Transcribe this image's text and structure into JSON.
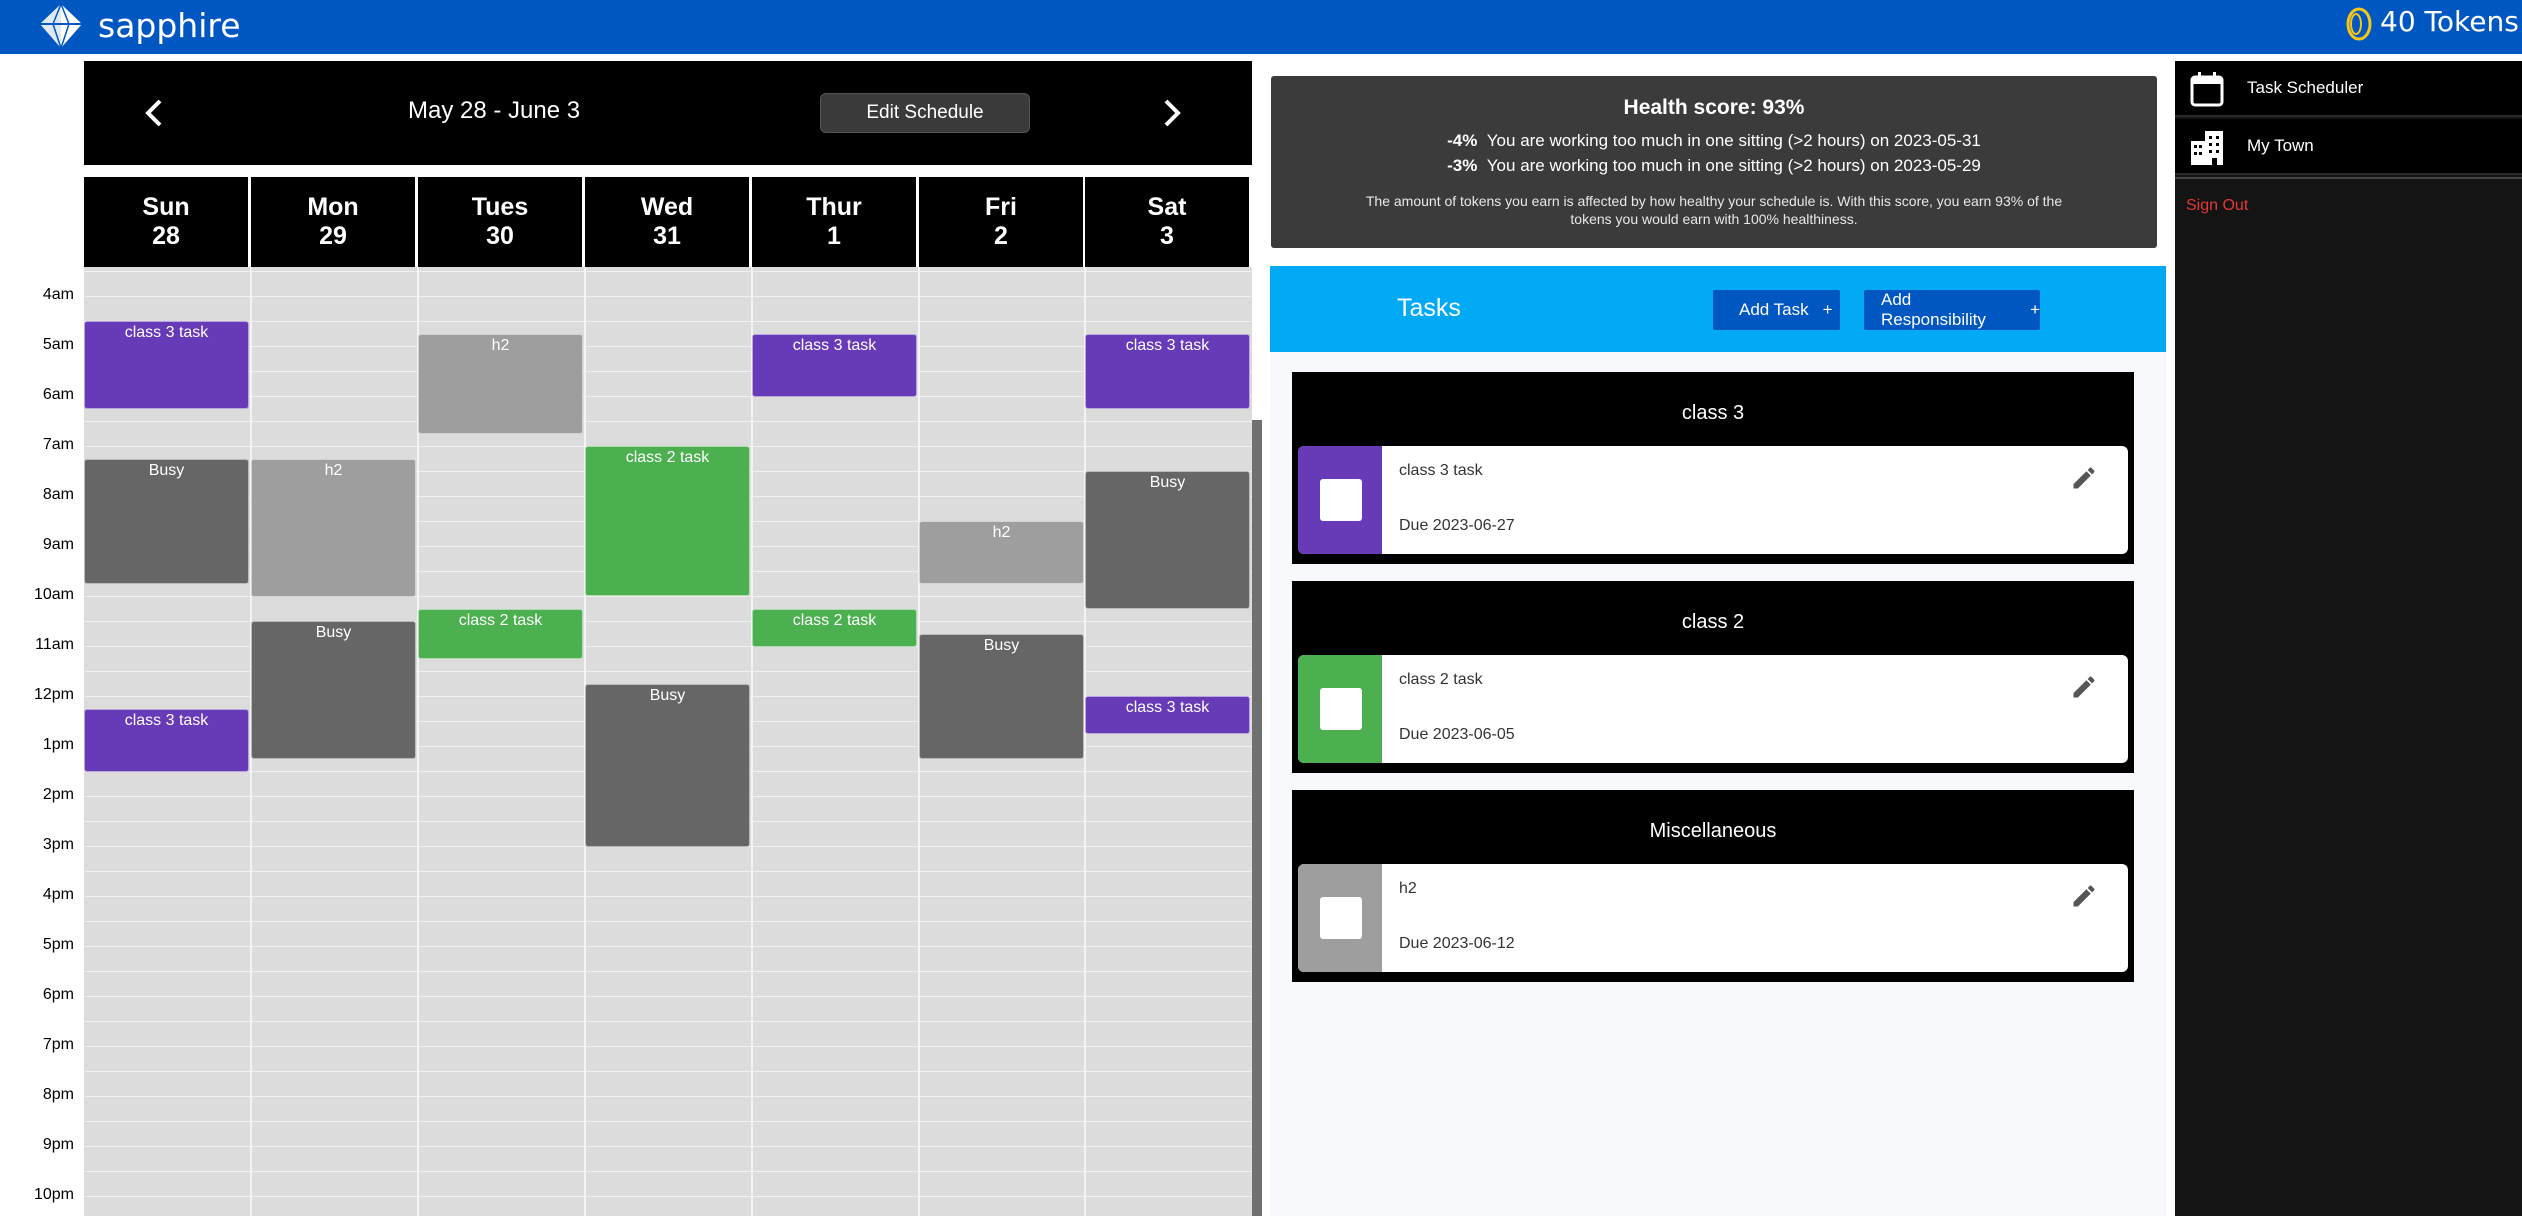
{
  "app": {
    "brand": "sapphire",
    "tokens": "40 Tokens"
  },
  "calendar": {
    "date_range": "May 28 - June 3",
    "edit_label": "Edit Schedule",
    "days": [
      {
        "name": "Sun",
        "num": "28"
      },
      {
        "name": "Mon",
        "num": "29"
      },
      {
        "name": "Tues",
        "num": "30"
      },
      {
        "name": "Wed",
        "num": "31"
      },
      {
        "name": "Thur",
        "num": "1"
      },
      {
        "name": "Fri",
        "num": "2"
      },
      {
        "name": "Sat",
        "num": "3"
      }
    ],
    "hours": [
      "4am",
      "5am",
      "6am",
      "7am",
      "8am",
      "9am",
      "10am",
      "11am",
      "12pm",
      "1pm",
      "2pm",
      "3pm",
      "4pm",
      "5pm",
      "6pm",
      "7pm",
      "8pm",
      "9pm",
      "10pm"
    ],
    "events": [
      {
        "day": 0,
        "start": 4.5,
        "end": 6.25,
        "label": "class 3 task",
        "kind": "class3"
      },
      {
        "day": 0,
        "start": 7.25,
        "end": 9.75,
        "label": "Busy",
        "kind": "busy"
      },
      {
        "day": 0,
        "start": 12.25,
        "end": 13.5,
        "label": "class 3 task",
        "kind": "class3"
      },
      {
        "day": 1,
        "start": 7.25,
        "end": 10.0,
        "label": "h2",
        "kind": "h2"
      },
      {
        "day": 1,
        "start": 10.5,
        "end": 13.25,
        "label": "Busy",
        "kind": "busy"
      },
      {
        "day": 2,
        "start": 4.75,
        "end": 6.75,
        "label": "h2",
        "kind": "h2"
      },
      {
        "day": 2,
        "start": 10.25,
        "end": 11.25,
        "label": "class 2 task",
        "kind": "class2"
      },
      {
        "day": 3,
        "start": 7.0,
        "end": 10.0,
        "label": "class 2 task",
        "kind": "class2"
      },
      {
        "day": 3,
        "start": 11.75,
        "end": 15.0,
        "label": "Busy",
        "kind": "busy"
      },
      {
        "day": 4,
        "start": 4.75,
        "end": 6.0,
        "label": "class 3 task",
        "kind": "class3"
      },
      {
        "day": 4,
        "start": 10.25,
        "end": 11.0,
        "label": "class 2 task",
        "kind": "class2"
      },
      {
        "day": 5,
        "start": 8.5,
        "end": 9.75,
        "label": "h2",
        "kind": "h2"
      },
      {
        "day": 5,
        "start": 10.75,
        "end": 13.25,
        "label": "Busy",
        "kind": "busy"
      },
      {
        "day": 6,
        "start": 4.75,
        "end": 6.25,
        "label": "class 3 task",
        "kind": "class3"
      },
      {
        "day": 6,
        "start": 7.5,
        "end": 10.25,
        "label": "Busy",
        "kind": "busy"
      },
      {
        "day": 6,
        "start": 12.0,
        "end": 12.75,
        "label": "class 3 task",
        "kind": "class3"
      }
    ],
    "colors": {
      "class3": "#673ab7",
      "class2": "#4caf50",
      "h2": "#9e9e9e",
      "busy": "#666666"
    }
  },
  "health": {
    "title": "Health score: 93%",
    "warnings": [
      {
        "pct": "-4%",
        "text": "You are working too much in one sitting (>2 hours) on 2023-05-31"
      },
      {
        "pct": "-3%",
        "text": "You are working too much in one sitting (>2 hours) on 2023-05-29"
      }
    ],
    "note": "The amount of tokens you earn is affected by how healthy your schedule is. With this score, you earn 93% of the tokens you would earn with 100% healthiness."
  },
  "tasks": {
    "title": "Tasks",
    "add_task": "Add Task",
    "add_responsibility": "Add Responsibility",
    "plus": "+",
    "groups": [
      {
        "title": "class 3",
        "task": "class 3 task",
        "due": "Due 2023-06-27",
        "color": "#673ab7"
      },
      {
        "title": "class 2",
        "task": "class 2 task",
        "due": "Due 2023-06-05",
        "color": "#4caf50"
      },
      {
        "title": "Miscellaneous",
        "task": "h2",
        "due": "Due 2023-06-12",
        "color": "#9e9e9e"
      }
    ]
  },
  "sidebar": {
    "items": [
      {
        "label": "Task Scheduler",
        "icon": "calendar-icon"
      },
      {
        "label": "My Town",
        "icon": "town-icon"
      }
    ],
    "signout": "Sign Out"
  }
}
